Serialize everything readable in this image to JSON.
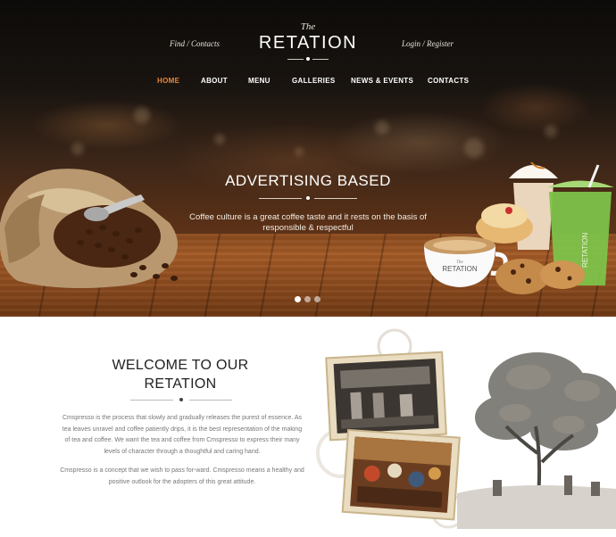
{
  "header": {
    "brand_prefix": "The",
    "brand_name": "RETATION",
    "find_contacts": "Find / Contacts",
    "login_register": "Login / Register"
  },
  "nav": {
    "items": [
      {
        "label": "HOME",
        "active": true
      },
      {
        "label": "ABOUT",
        "active": false
      },
      {
        "label": "MENU",
        "active": false
      },
      {
        "label": "GALLERIES",
        "active": false
      },
      {
        "label": "NEWS & EVENTS",
        "active": false
      },
      {
        "label": "CONTACTS",
        "active": false
      }
    ],
    "active_color": "#e8873a"
  },
  "hero": {
    "title": "ADVERTISING BASED",
    "text": "Coffee culture is a great coffee taste and it rests on the basis of responsible & respectful",
    "slides": 3,
    "active_slide": 1,
    "cup_brand": "RETATION",
    "cup_brand_small": "The",
    "cup_side_brand": "RETATION"
  },
  "welcome": {
    "title_line1": "WELCOME TO OUR",
    "title_line2": "RETATION",
    "paragraph1": "Cmspresso is the process that slowly and gradually releases the purest of essence. As tea leaves unravel and coffee patiently drips, it is the best representation of the making of tea and coffee. We want the tea and coffee from Cmspresso to express their many levels of character through a thoughtful and caring hand.",
    "paragraph2": "Cmspresso is a concept that we wish to pass for-ward. Cmspresso means a healthy and positive outlook for the adopters of this great attitude."
  }
}
